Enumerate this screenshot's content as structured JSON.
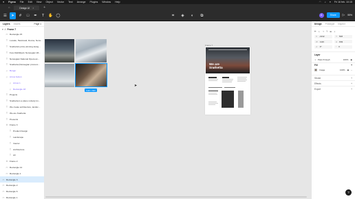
{
  "menubar": {
    "items": [
      "Figma",
      "File",
      "Edit",
      "View",
      "Object",
      "Vector",
      "Text",
      "Arrange",
      "Plugins",
      "Window",
      "Help"
    ],
    "clock": "Fri 16 feb. 10:15"
  },
  "tabbar": {
    "active_tab": "Design UI",
    "add": "+"
  },
  "toolbar": {
    "zoom": "55%",
    "avatar_initial": "A",
    "share_label": "Share"
  },
  "left_panel": {
    "tabs": {
      "layers": "Layers",
      "assets": "Assets",
      "page": "Page 1"
    },
    "frame_name": "Frame 7",
    "layers": [
      {
        "label": "Rectangle 15",
        "icon": "rectangle-icon",
        "indent": 2
      },
      {
        "label": "Locatio, Harstrand, Dunna, Norw...",
        "icon": "text-icon",
        "indent": 2
      },
      {
        "label": "Snøhetta's prize-winning desig...",
        "icon": "text-icon",
        "indent": 2
      },
      {
        "label": "Fore Rabbifjord, Norwegian Wi...",
        "icon": "text-icon",
        "indent": 2
      },
      {
        "label": "Norwegian National Opera an...",
        "icon": "text-icon",
        "indent": 2
      },
      {
        "label": "Snøhetta (Norwegian pronunc...",
        "icon": "text-icon",
        "indent": 2
      },
      {
        "label": "Burger",
        "icon": "component-icon",
        "indent": 2,
        "purple": true
      },
      {
        "label": "Arrow button",
        "icon": "component-icon",
        "indent": 2,
        "purple": true
      },
      {
        "label": "Arrow 1",
        "icon": "component-icon",
        "indent": 4,
        "purple": true
      },
      {
        "label": "Rectangle 18",
        "icon": "component-icon",
        "indent": 4,
        "purple": true
      },
      {
        "label": "Projects",
        "icon": "text-icon",
        "indent": 2
      },
      {
        "label": "Snøhetta is a place nobody kn...",
        "icon": "text-icon",
        "indent": 2
      },
      {
        "label": "We create architecture, landsc...",
        "icon": "text-icon",
        "indent": 2
      },
      {
        "label": "We are Snøhetta",
        "icon": "text-icon",
        "indent": 2
      },
      {
        "label": "Presents",
        "icon": "text-icon",
        "indent": 2
      },
      {
        "label": "Frame 3",
        "icon": "frame-icon",
        "indent": 2
      },
      {
        "label": "Product Design",
        "icon": "text-icon",
        "indent": 4
      },
      {
        "label": "Landscape",
        "icon": "text-icon",
        "indent": 4
      },
      {
        "label": "Interior",
        "icon": "text-icon",
        "indent": 4
      },
      {
        "label": "Architecture",
        "icon": "text-icon",
        "indent": 4
      },
      {
        "label": "All",
        "icon": "text-icon",
        "indent": 4
      },
      {
        "label": "Frame 2",
        "icon": "frame-icon",
        "indent": 2
      },
      {
        "label": "Rectangle 12",
        "icon": "rectangle-icon",
        "indent": 2
      },
      {
        "label": "Rectangle 1",
        "icon": "rectangle-icon",
        "indent": 2
      },
      {
        "label": "Rectangle 3",
        "icon": "rectangle-icon",
        "indent": 0,
        "selected": true
      },
      {
        "label": "Rectangle 2",
        "icon": "rectangle-icon",
        "indent": 0
      },
      {
        "label": "Rectangle 6",
        "icon": "rectangle-icon",
        "indent": 0
      },
      {
        "label": "Rectangle 1",
        "icon": "rectangle-icon",
        "indent": 0
      }
    ]
  },
  "canvas": {
    "size_tag": "1110 × 600",
    "frame_label": "Frame 7",
    "hero_title_line1": "We are",
    "hero_title_line2": "Snøhetta"
  },
  "right_panel": {
    "tabs": {
      "design": "Design",
      "prototype": "Prototype",
      "inspect": "Inspect"
    },
    "x_label": "X",
    "x_value": "-3132",
    "y_label": "Y",
    "y_value": "508",
    "w_label": "W",
    "w_value": "1116",
    "h_label": "H",
    "h_value": "849",
    "rotation_value": "0°",
    "radius_value": "0",
    "layer_title": "Layer",
    "blend_value": "Pass through",
    "opacity_value": "100%",
    "fill_title": "Fill",
    "fill_value": "Image",
    "fill_opacity": "100%",
    "stroke_title": "Stroke",
    "effects_title": "Effects",
    "export_title": "Export"
  }
}
